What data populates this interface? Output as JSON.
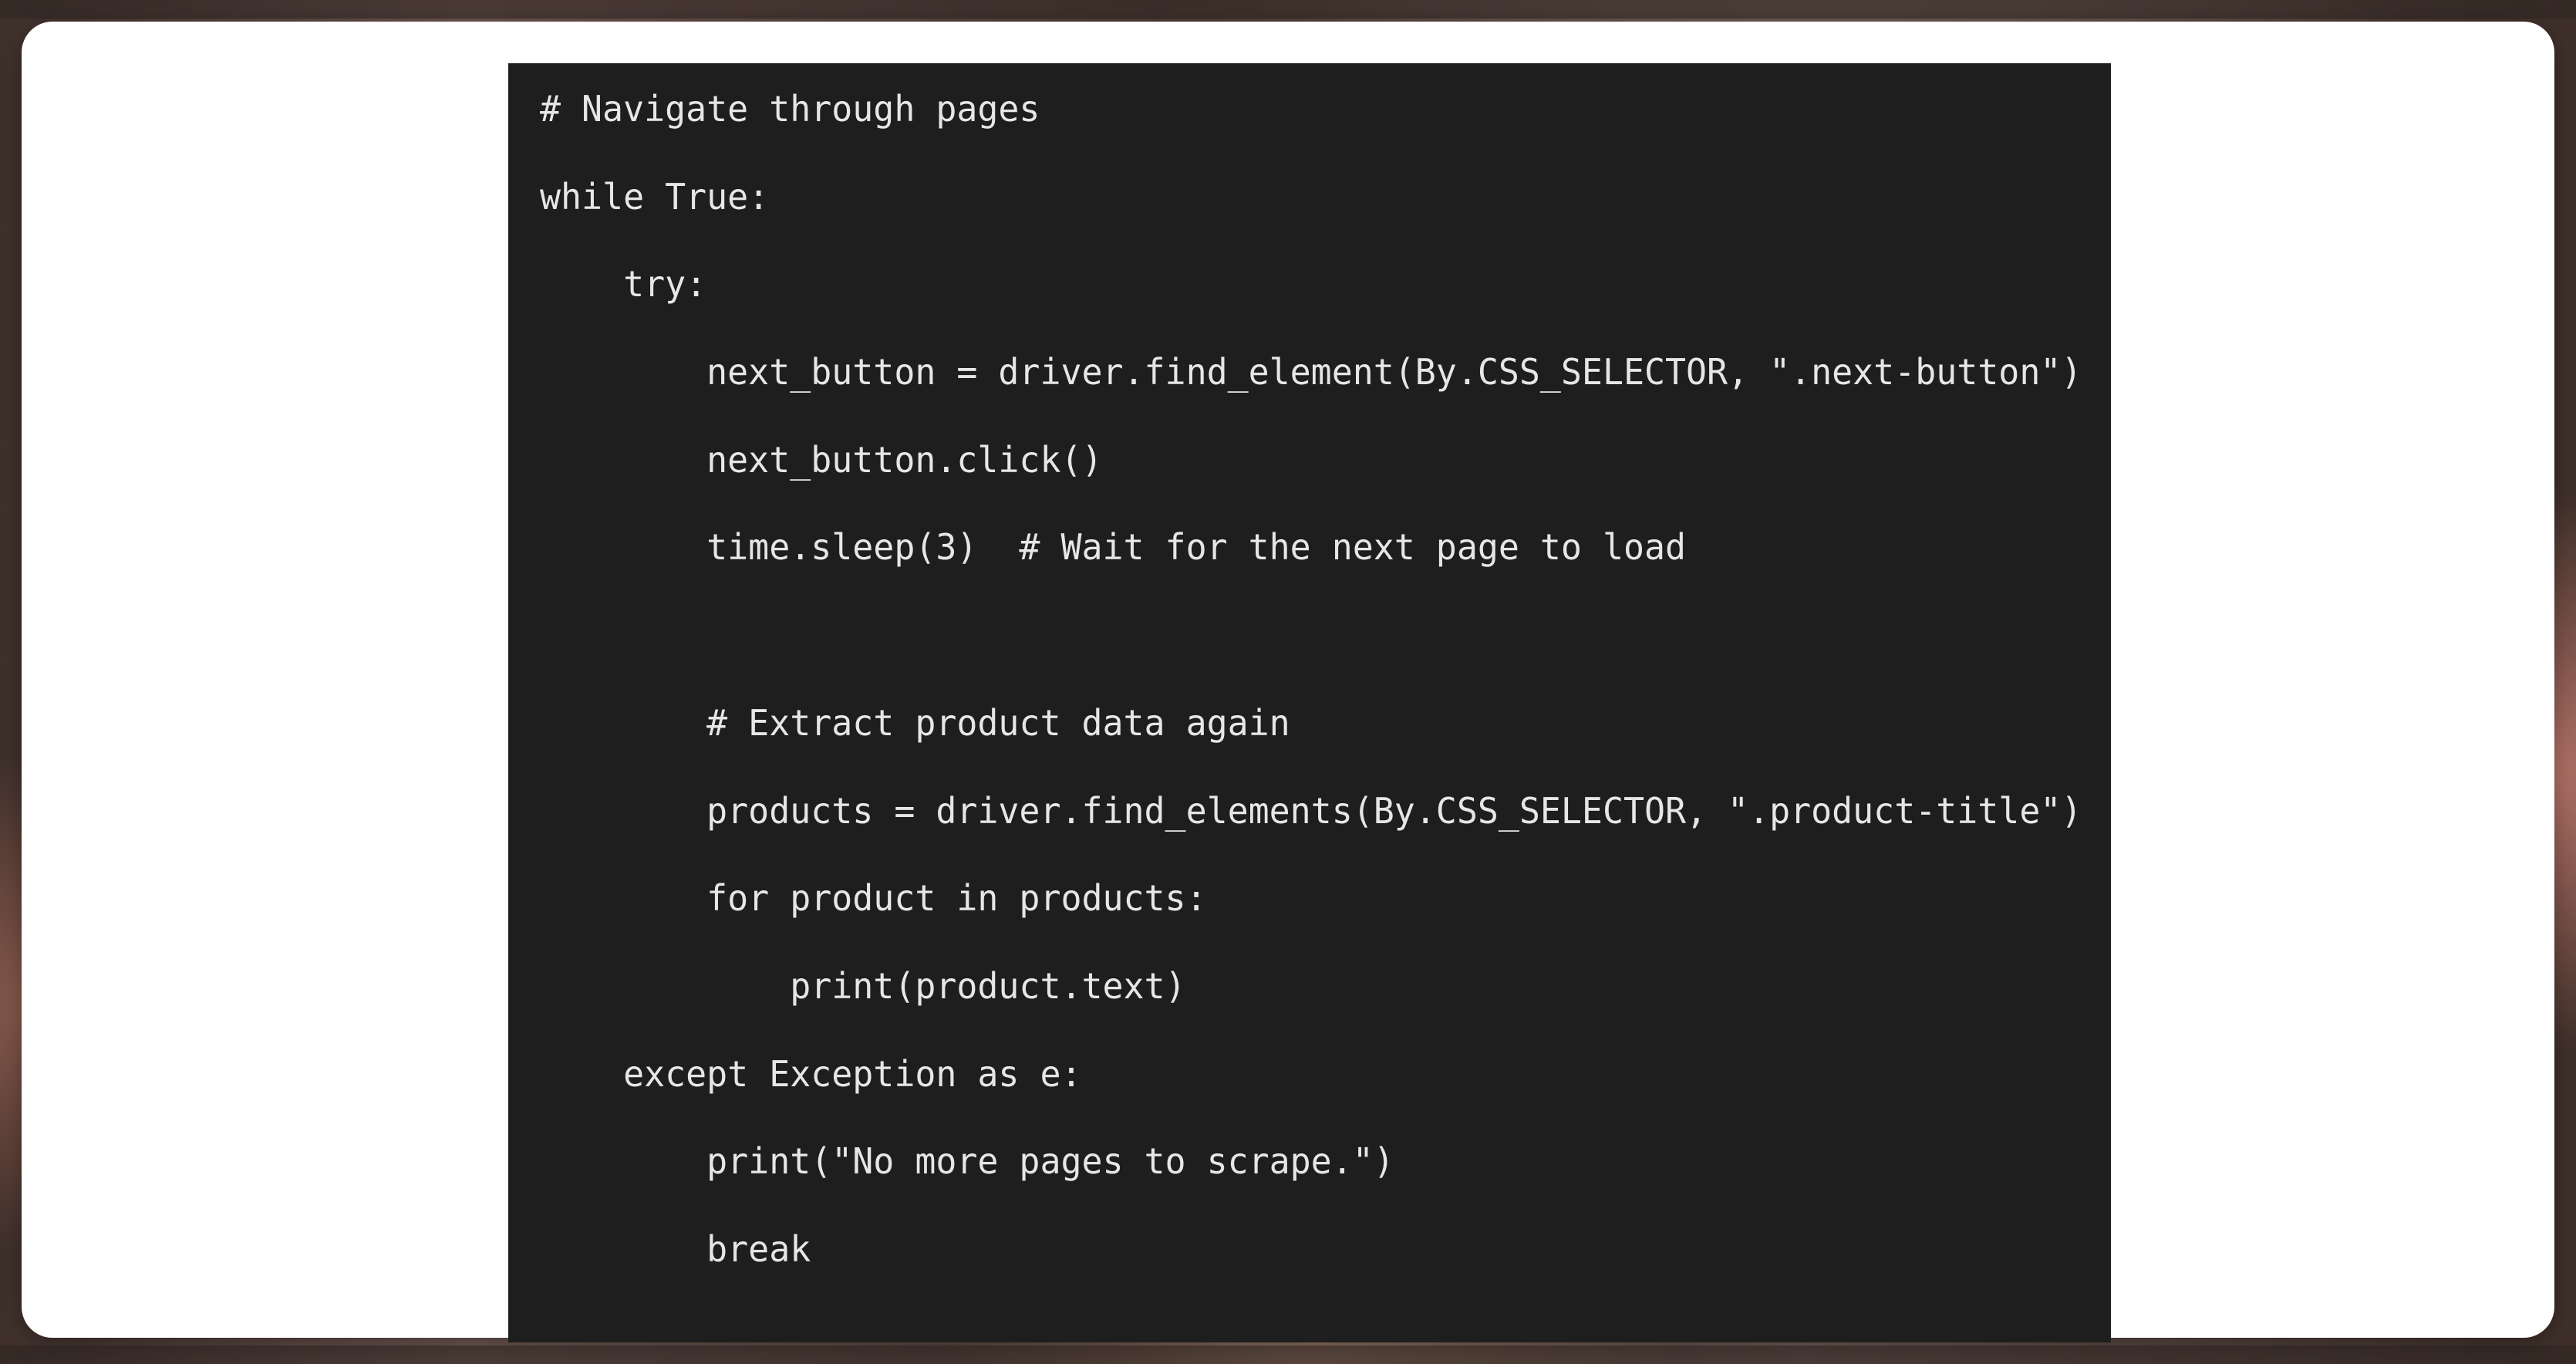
{
  "colors": {
    "card_background": "#ffffff",
    "code_background": "#1e1e1e",
    "code_text": "#e6e6e6"
  },
  "code": {
    "language": "python",
    "lines": [
      "# Navigate through pages",
      "while True:",
      "    try:",
      "        next_button = driver.find_element(By.CSS_SELECTOR, \".next-button\")",
      "        next_button.click()",
      "        time.sleep(3)  # Wait for the next page to load",
      "",
      "        # Extract product data again",
      "        products = driver.find_elements(By.CSS_SELECTOR, \".product-title\")",
      "        for product in products:",
      "            print(product.text)",
      "    except Exception as e:",
      "        print(\"No more pages to scrape.\")",
      "        break"
    ]
  }
}
